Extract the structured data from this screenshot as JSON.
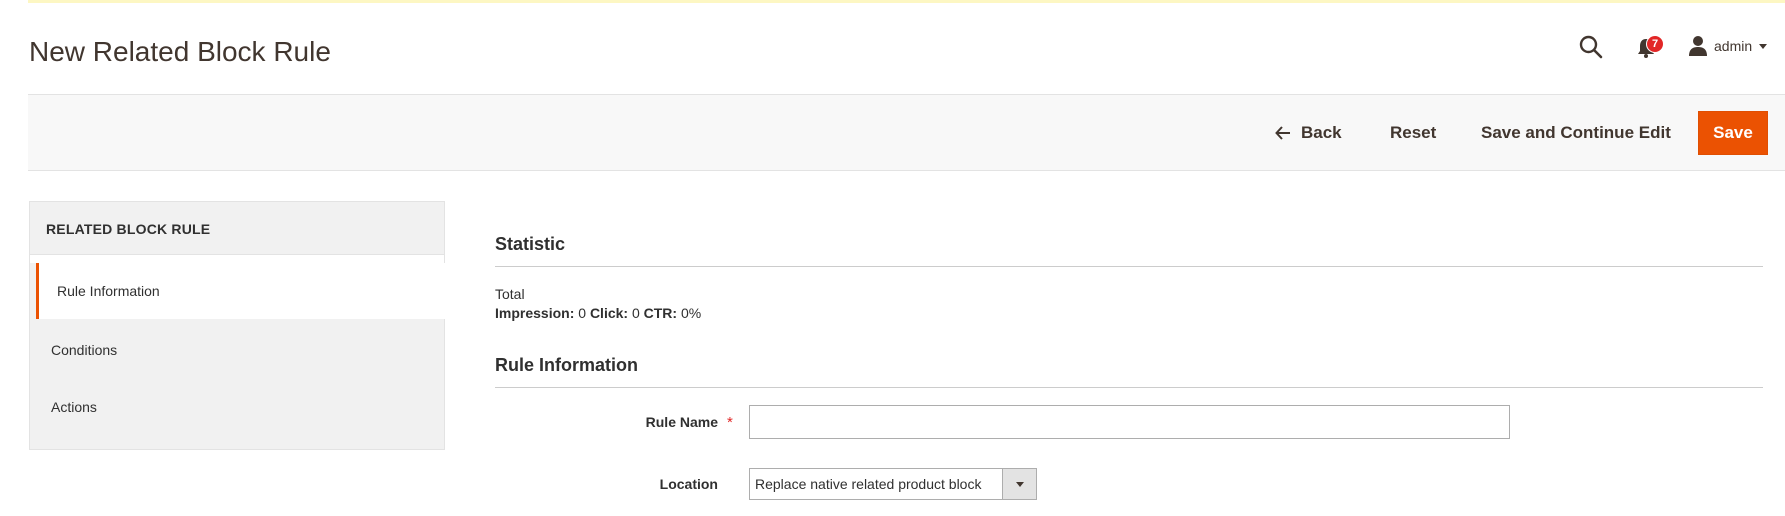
{
  "page": {
    "title": "New Related Block Rule"
  },
  "header": {
    "notification_count": "7",
    "user_name": "admin"
  },
  "toolbar": {
    "back_label": "Back",
    "reset_label": "Reset",
    "save_continue_label": "Save and Continue Edit",
    "save_label": "Save",
    "accent_color": "#eb5202"
  },
  "sidebar": {
    "title": "RELATED BLOCK RULE",
    "items": [
      {
        "label": "Rule Information",
        "active": true
      },
      {
        "label": "Conditions",
        "active": false
      },
      {
        "label": "Actions",
        "active": false
      }
    ]
  },
  "statistic": {
    "title": "Statistic",
    "total_label": "Total",
    "impression_label": "Impression:",
    "impression_value": "0",
    "click_label": "Click:",
    "click_value": "0",
    "ctr_label": "CTR:",
    "ctr_value": "0%"
  },
  "rule_information": {
    "title": "Rule Information",
    "rule_name_label": "Rule Name",
    "rule_name_value": "",
    "location_label": "Location",
    "location_value": "Replace native related product block"
  },
  "icons": {
    "search": "search-icon",
    "bell": "bell-icon",
    "user": "user-icon",
    "caret": "caret-down-icon",
    "back_arrow": "arrow-left-icon"
  }
}
